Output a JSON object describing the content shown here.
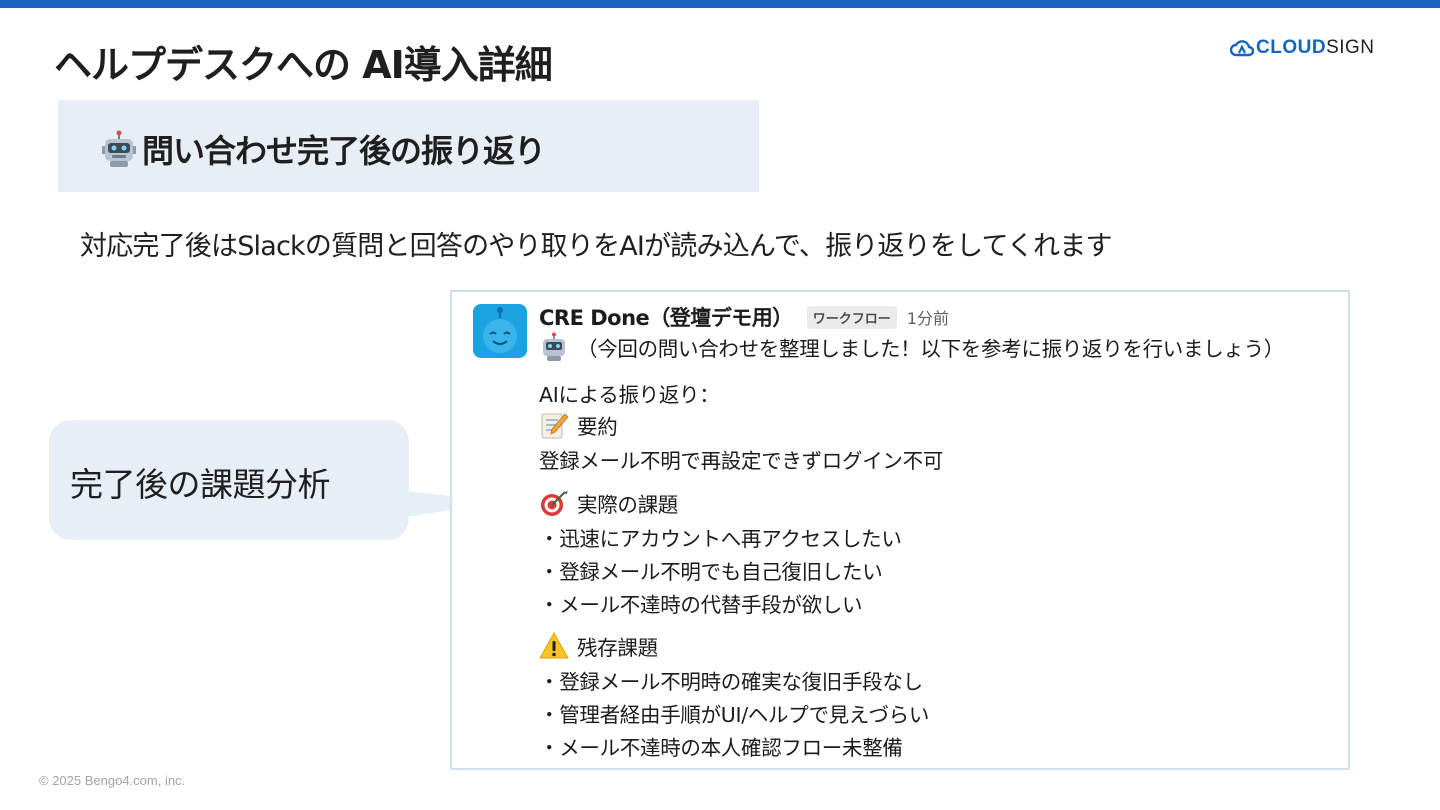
{
  "slide": {
    "title": "ヘルプデスクへの AI導入詳細",
    "logo": {
      "part1": "CLOUD",
      "part2": "SIGN"
    },
    "section_title": "問い合わせ完了後の振り返り",
    "description": "対応完了後はSlackの質問と回答のやり取りをAIが読み込んで、振り返りをしてくれます",
    "callout_text": "完了後の課題分析",
    "footer": "© 2025 Bengo4.com, inc."
  },
  "message": {
    "sender": "CRE Done（登壇デモ用）",
    "badge": "ワークフロー",
    "time": "1分前",
    "intro": "（今回の問い合わせを整理しました！以下を参考に振り返りを行いましょう）",
    "heading": "AIによる振り返り：",
    "summary_label": "要約",
    "summary_text": "登録メール不明で再設定できずログイン不可",
    "issues_label": "実際の課題",
    "issues": [
      "・迅速にアカウントへ再アクセスしたい",
      "・登録メール不明でも自己復旧したい",
      "・メール不達時の代替手段が欲しい"
    ],
    "remaining_label": "残存課題",
    "remaining": [
      "・登録メール不明時の確実な復旧手段なし",
      "・管理者経由手順がUI/ヘルプで見えづらい",
      "・メール不達時の本人確認フロー未整備"
    ]
  },
  "icons": {
    "section": "robot-icon",
    "intro": "robot-icon",
    "summary": "memo-icon",
    "issues": "target-icon",
    "remaining": "warning-icon"
  },
  "colors": {
    "accent": "#1565c0",
    "panel": "#e8eef6",
    "avatar": "#1aa3e0",
    "card_border": "#cfdff0"
  }
}
